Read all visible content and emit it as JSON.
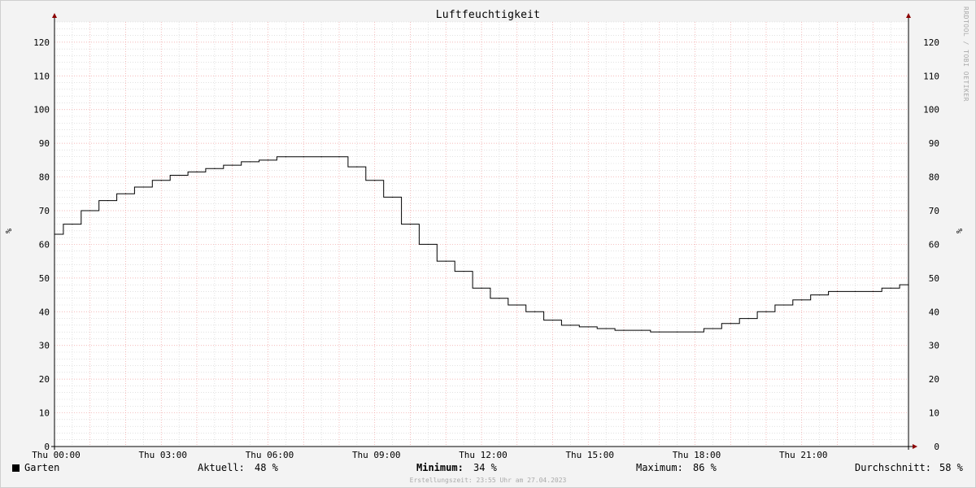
{
  "chart_data": {
    "type": "line",
    "title": "Luftfeuchtigkeit",
    "ylabel": "%",
    "ylim": [
      0,
      126
    ],
    "y_ticks": [
      "0",
      "10",
      "20",
      "30",
      "40",
      "50",
      "60",
      "70",
      "80",
      "90",
      "100",
      "110",
      "120"
    ],
    "x_tick_labels": [
      "Thu 00:00",
      "Thu 03:00",
      "Thu 06:00",
      "Thu 09:00",
      "Thu 12:00",
      "Thu 15:00",
      "Thu 18:00",
      "Thu 21:00"
    ],
    "x_range_hours": [
      0,
      24
    ],
    "grid": true,
    "series": [
      {
        "name": "Garten",
        "color": "#000000",
        "x_hours": [
          0,
          0.5,
          1.0,
          1.5,
          2.0,
          2.5,
          3.0,
          3.5,
          4.0,
          4.5,
          5.0,
          5.5,
          6.0,
          6.5,
          7.0,
          7.5,
          8.0,
          8.5,
          9.0,
          9.5,
          10.0,
          10.5,
          11.0,
          11.5,
          12.0,
          12.5,
          13.0,
          13.5,
          14.0,
          14.5,
          15.0,
          15.5,
          16.0,
          16.5,
          17.0,
          17.5,
          18.0,
          18.5,
          19.0,
          19.5,
          20.0,
          20.5,
          21.0,
          21.5,
          22.0,
          22.5,
          23.0,
          23.5,
          24.0
        ],
        "values": [
          63,
          66,
          70,
          73,
          75,
          77,
          79,
          80.5,
          81.5,
          82.5,
          83.5,
          84.5,
          85,
          86,
          86,
          86,
          86,
          83,
          79,
          74,
          66,
          60,
          55,
          52,
          47,
          44,
          42,
          40,
          37.5,
          36,
          35.5,
          35,
          34.5,
          34.5,
          34,
          34,
          34,
          35,
          36.5,
          38,
          40,
          42,
          43.5,
          45,
          46,
          46,
          46,
          47,
          48
        ]
      }
    ]
  },
  "legend": {
    "series_name": "Garten",
    "current_label": "Aktuell:",
    "current_value": "48 %",
    "min_label": "Minimum:",
    "min_value": "34 %",
    "max_label": "Maximum:",
    "max_value": "86 %",
    "avg_label": "Durchschnitt:",
    "avg_value": "58 %"
  },
  "footer": "Erstellungszeit: 23:55 Uhr am 27.04.2023",
  "watermark": "RRDTOOL / TOBI OETIKER",
  "colors": {
    "background": "#f3f3f3",
    "canvas": "#ffffff",
    "major_grid": "#f0a0a0",
    "minor_grid": "#cfcfcf",
    "axis_arrow": "#8b0000"
  }
}
